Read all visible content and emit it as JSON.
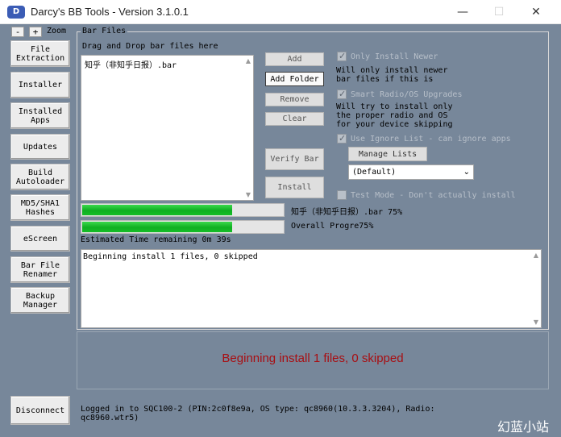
{
  "window": {
    "title": "Darcy's BB Tools - Version 3.1.0.1",
    "icon_glyph": "D",
    "minimize_glyph": "—",
    "maximize_glyph": "☐",
    "close_glyph": "✕"
  },
  "zoom": {
    "minus": "-",
    "plus": "+",
    "label": "Zoom"
  },
  "sidebar": {
    "items": [
      {
        "label": "File\nExtraction"
      },
      {
        "label": "Installer"
      },
      {
        "label": "Installed\nApps"
      },
      {
        "label": "Updates"
      },
      {
        "label": "Build\nAutoloader"
      },
      {
        "label": "MD5/SHA1\nHashes"
      },
      {
        "label": "eScreen"
      },
      {
        "label": "Bar File\nRenamer"
      },
      {
        "label": "Backup\nManager"
      }
    ],
    "disconnect": "Disconnect"
  },
  "bar_files": {
    "group_title": "Bar Files",
    "drop_label": "Drag and Drop bar files here",
    "files": [
      "知乎（非知乎日报）.bar"
    ],
    "buttons": {
      "add": "Add",
      "add_folder": "Add Folder",
      "remove": "Remove",
      "clear": "Clear",
      "verify": "Verify Bar",
      "install": "Install"
    }
  },
  "options": {
    "only_install_newer": {
      "label": "Only Install Newer",
      "desc": "Will only install newer\nbar files if this is",
      "checked": true
    },
    "smart_radio": {
      "label": "Smart Radio/OS Upgrades",
      "desc": "Will try to install only\nthe proper radio and OS\nfor your device skipping",
      "checked": true
    },
    "ignore_list": {
      "label": "Use Ignore List - can ignore apps",
      "checked": true
    },
    "manage_lists": "Manage Lists",
    "list_select": {
      "value": "(Default)",
      "chevron": "⌄"
    },
    "test_mode": {
      "label": "Test Mode - Don't actually install",
      "checked": false
    }
  },
  "progress": {
    "file": {
      "label": "知乎（非知乎日报）.bar 75%",
      "value": 0.75
    },
    "overall": {
      "label": "Overall Progre75%",
      "value": 0.75
    },
    "eta": "Estimated Time remaining 0m 39s"
  },
  "log": {
    "text": "Beginning install 1 files, 0 skipped"
  },
  "status": {
    "text": "Beginning install 1 files, 0 skipped"
  },
  "footer": {
    "login_info": "Logged in to SQC100-2 (PIN:2c0f8e9a, OS type: qc8960(10.3.3.3204), Radio: qc8960.wtr5)"
  },
  "watermark": "幻蓝小站",
  "colors": {
    "client_bg": "#77879a",
    "status_text": "#a80e12",
    "progress_fill": "#16be28"
  }
}
